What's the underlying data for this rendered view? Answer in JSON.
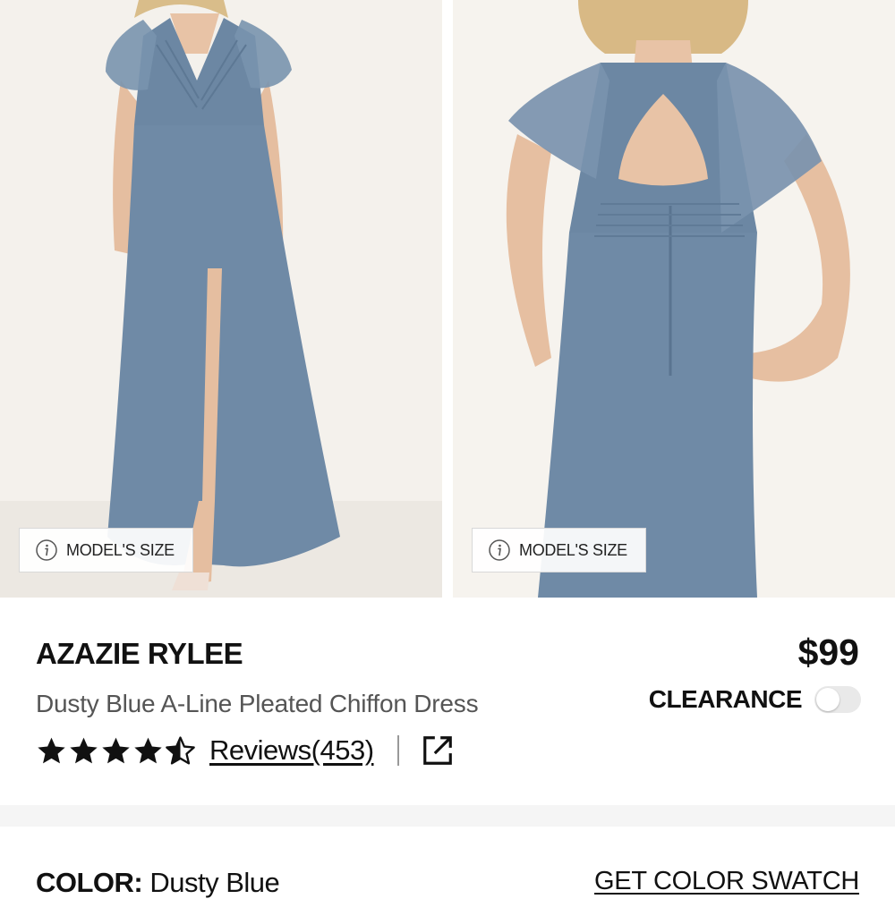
{
  "gallery": {
    "model_size_label": "MODEL'S SIZE",
    "dress_color": "#6f8aa6",
    "background_color": "#f4f1ec"
  },
  "product": {
    "brand": "AZAZIE RYLEE",
    "price": "$99",
    "subtitle": "Dusty Blue A-Line Pleated Chiffon Dress",
    "rating": 4.5,
    "reviews_label": "Reviews(453)",
    "clearance_label": "CLEARANCE",
    "clearance_on": false
  },
  "color": {
    "key": "COLOR:",
    "value": "Dusty Blue",
    "swatch_link": "GET COLOR SWATCH"
  },
  "icons": {
    "info": "info-icon",
    "star": "star-icon",
    "half_star": "half-star-icon",
    "share": "share-external-icon"
  }
}
